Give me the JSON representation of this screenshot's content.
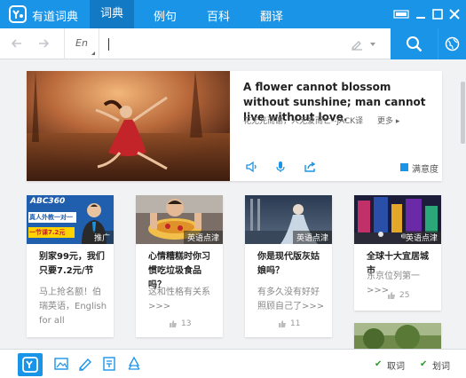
{
  "app": {
    "title": "有道词典"
  },
  "nav": {
    "tabs": [
      {
        "label": "词典"
      },
      {
        "label": "例句"
      },
      {
        "label": "百科"
      },
      {
        "label": "翻译"
      }
    ],
    "active_tab": "词典"
  },
  "search": {
    "language": "En",
    "value": ""
  },
  "feature": {
    "quote_en": "A flower cannot blossom without sunshine; man cannot live without love.",
    "quote_cn": "花无光而谢，人无爱而亡--JACK译",
    "more_label": "更多",
    "favorite_label": "满意度"
  },
  "cards": [
    {
      "img_text_1": "ABC360",
      "img_text_2": "真人外教一对一",
      "img_text_3": "一节课7.2元",
      "tag": "推广",
      "title": "别家99元，我们只要7.2元/节",
      "desc": "马上抢名额！伯瑞英语，English for all",
      "likes": ""
    },
    {
      "tag": "英语点津",
      "title": "心情糟糕时你习惯吃垃圾食品吗？",
      "desc": "这和性格有关系>>>",
      "likes": "13"
    },
    {
      "tag": "英语点津",
      "title": "你是现代版灰姑娘吗？",
      "desc": "有多久没有好好照顾自己了>>>",
      "likes": "11"
    },
    {
      "tag": "英语点津",
      "title": "全球十大宜居城市",
      "desc": "东京位列第一>>>",
      "likes": "25"
    }
  ],
  "bottom": {
    "take_word_label": "取词",
    "select_word_label": "划词"
  },
  "colors": {
    "brand": "#1a94e6",
    "check": "#2a9a2a"
  }
}
